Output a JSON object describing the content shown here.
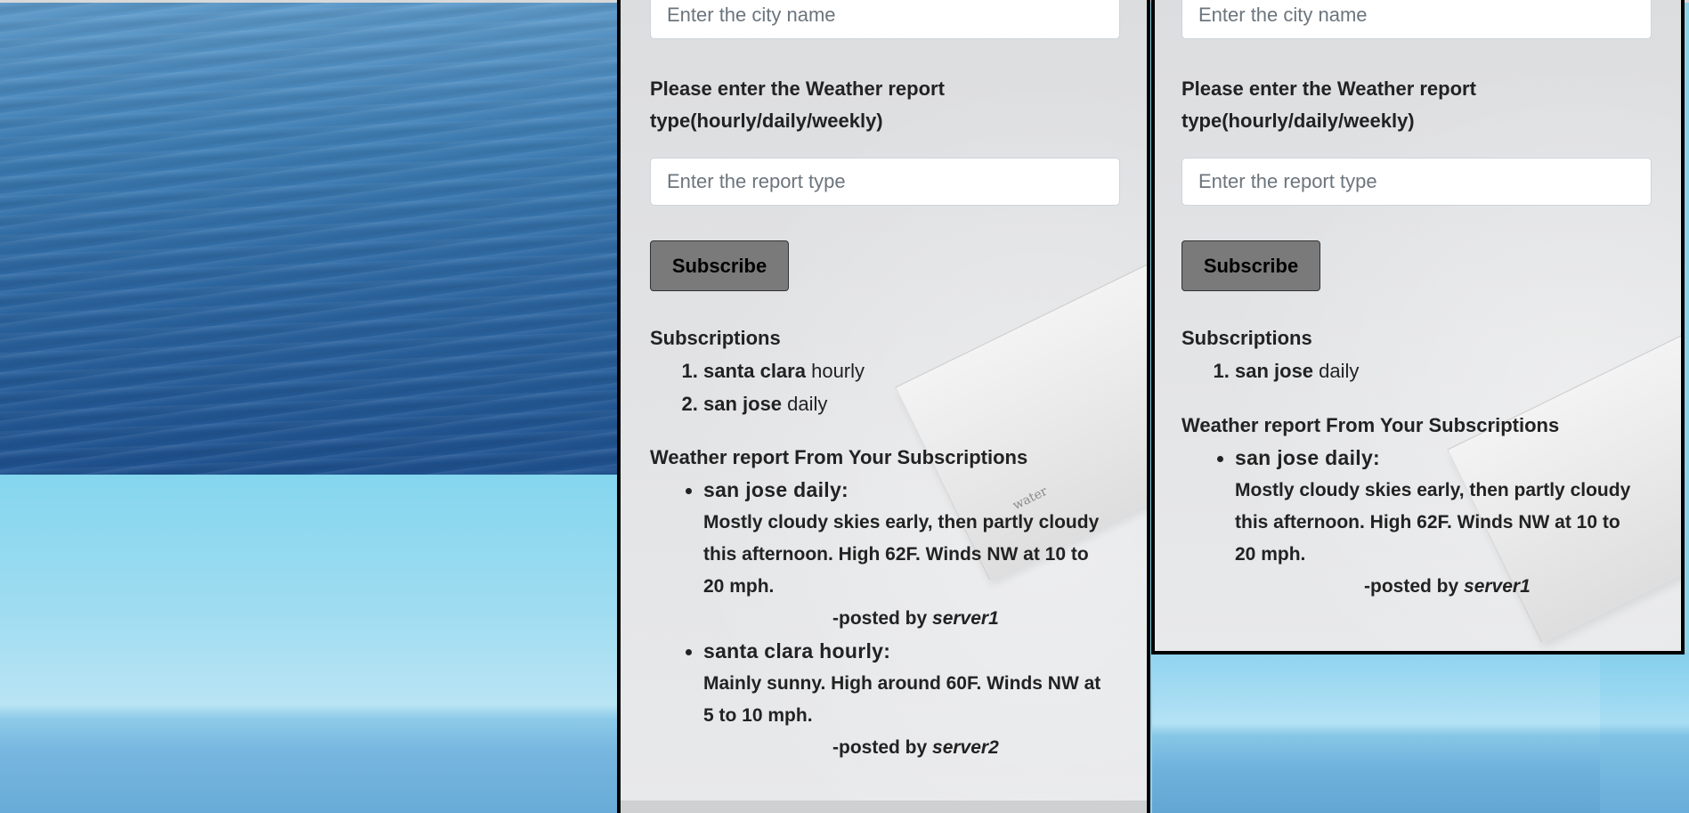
{
  "panels": [
    {
      "city_placeholder": "Enter the city name",
      "report_prompt": "Please enter the Weather report type(hourly/daily/weekly)",
      "report_placeholder": "Enter the report type",
      "subscribe_label": "Subscribe",
      "subscriptions_title": "Subscriptions",
      "subscriptions": [
        {
          "city": "santa clara",
          "type": "hourly"
        },
        {
          "city": "san jose",
          "type": "daily"
        }
      ],
      "reports_title": "Weather report From Your Subscriptions",
      "reports": [
        {
          "heading": "san jose daily:",
          "body": "Mostly cloudy skies early, then partly cloudy this afternoon. High 62F. Winds NW at 10 to 20 mph.",
          "posted_prefix": "-posted by",
          "server": "server1"
        },
        {
          "heading": "santa clara hourly:",
          "body": "Mainly sunny. High around 60F. Winds NW at 5 to 10 mph.",
          "posted_prefix": "-posted by",
          "server": "server2"
        }
      ]
    },
    {
      "city_placeholder": "Enter the city name",
      "report_prompt": "Please enter the Weather report type(hourly/daily/weekly)",
      "report_placeholder": "Enter the report type",
      "subscribe_label": "Subscribe",
      "subscriptions_title": "Subscriptions",
      "subscriptions": [
        {
          "city": "san jose",
          "type": "daily"
        }
      ],
      "reports_title": "Weather report From Your Subscriptions",
      "reports": [
        {
          "heading": "san jose daily:",
          "body": "Mostly cloudy skies early, then partly cloudy this afternoon. High 62F. Winds NW at 10 to 20 mph.",
          "posted_prefix": "-posted by",
          "server": "server1"
        }
      ]
    }
  ],
  "decor": {
    "book_word": "water"
  }
}
